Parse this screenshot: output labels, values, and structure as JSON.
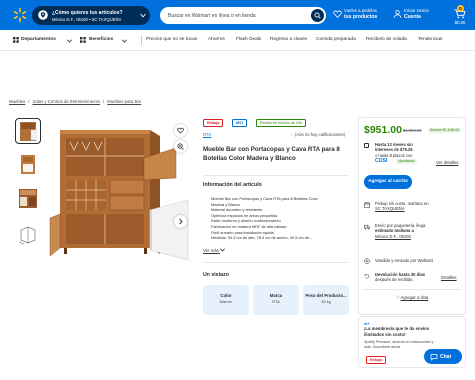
{
  "colors": {
    "brand_blue": "#0071dc",
    "navy": "#002d58",
    "spark_yellow": "#ffc220",
    "price_green": "#2a8703",
    "rollback_red": "#de1c24"
  },
  "header": {
    "store_line1": "¿Cómo quieres tus artículos?",
    "store_line2": "México D.F., 06100 • SC TAXQUEÑA",
    "search_placeholder": "Buscar en Walmart en línea o en tienda",
    "orders_line1": "Vuelve a pedirlos",
    "orders_line2": "tus productos",
    "account_line1": "Iniciar sesión",
    "account_line2": "Cuenta",
    "cart_count": "0",
    "cart_amount": "$0.00",
    "icons": [
      "spark-logo",
      "pin-icon",
      "search-icon",
      "heart-icon",
      "user-icon",
      "cart-icon"
    ]
  },
  "nav": {
    "departments": "Departamentos",
    "benefits": "Beneficios",
    "links": [
      "Precios que no se tocan",
      "Ahorros",
      "Flash Deals",
      "Regreso a clases",
      "Comida preparada",
      "Recibelo de volada",
      "Tendencias"
    ]
  },
  "breadcrumb": [
    "Muebles",
    "Salas y Centros de Entretenimiento",
    "Muebles para Bar"
  ],
  "product": {
    "badges": {
      "rollback": "Rebaja",
      "mas": "MSI",
      "returns": "Recibe en menos de 24h"
    },
    "brand": "RTA",
    "rating_text": "(Aún no hay calificaciones)",
    "title": "Mueble Bar con Portacopas y Cava RTA para 8 Botellas Color Madera y Blanco",
    "details_heading": "Información del artículo",
    "bullets": [
      "Mueble Bar con Portacopas y Cava RTA para 8 Botellas Color",
      "Madera y Blanco",
      "Material duradero y resistente",
      "Optimiza espacios en áreas pequeñas",
      "Estilo moderno y diseño contemporáneo",
      "Fabricación en madera MDF de alta calidad",
      "Fácil armado para instalación rápida",
      "Medidas: 94.9 cm de alto, 78.9 cm de ancho, 40.5 cm de..."
    ],
    "see_more": "Ver más",
    "glance_heading": "Un vistazo",
    "specs": [
      {
        "key": "Color",
        "value": "Marrón"
      },
      {
        "key": "Marca",
        "value": "RTA"
      },
      {
        "key": "Peso del Producto...",
        "value": "35 kg"
      }
    ]
  },
  "buybox": {
    "price": "$951.00",
    "old_price": "$1,999.00",
    "save": "Ahorra $1,048.00",
    "installments_line1": "Hasta 12 meses sin",
    "installments_line2": "intereses de $79.25",
    "installments_line3": "o hasta 8 plazos con",
    "cosi": "COSI",
    "cosi_pill": "¡Aprobado!",
    "see_details": "Ver detalles",
    "add_to_cart": "Agregar al carrito",
    "pickup_line1": "Pickup sin costo, mañana en",
    "pickup_line2": "SC TAXQUEÑA",
    "delivery_line1": "Envío por paquetería, llega",
    "delivery_line2": "estimado mañana a",
    "delivery_line3": "México D.F., 06100",
    "seller": "Vendido y enviado por Walmart",
    "returns_line1": "Devolución hasta 30 días",
    "returns_line2": "después de recibido.",
    "returns_details": "Detalles",
    "favorites": "Agregar a lista"
  },
  "membership": {
    "brand": "w+",
    "title": "¡La membresía que te da envíos ilimitados sin costo!",
    "sub1": "Spotify Premium, ahorros en restaurantes y",
    "sub2_prefix": "más.",
    "sub2_link": "Suscríbete ahora",
    "badge": "Rebaja"
  },
  "chat": {
    "label": "Chat"
  }
}
